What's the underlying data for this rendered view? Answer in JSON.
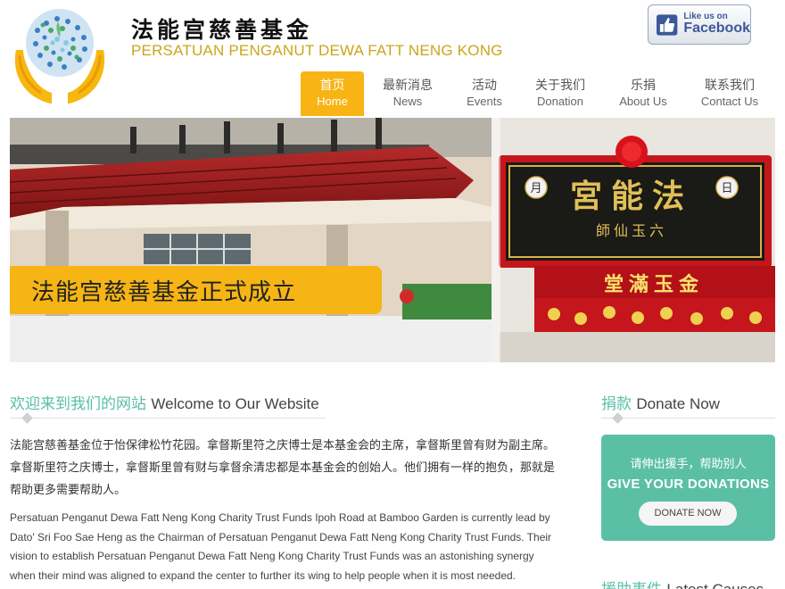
{
  "site": {
    "title_cn": "法能宫慈善基金",
    "title_en": "PERSATUAN PENGANUT DEWA FATT NENG KONG"
  },
  "facebook": {
    "small": "Like us on",
    "big": "Facebook"
  },
  "nav": [
    {
      "cn": "首页",
      "en": "Home",
      "active": true
    },
    {
      "cn": "最新消息",
      "en": "News",
      "active": false
    },
    {
      "cn": "活动",
      "en": "Events",
      "active": false
    },
    {
      "cn": "关于我们",
      "en": "Donation",
      "active": false
    },
    {
      "cn": "乐捐",
      "en": "About Us",
      "active": false
    },
    {
      "cn": "联系我们",
      "en": "Contact Us",
      "active": false
    }
  ],
  "banner": {
    "caption": "法能宫慈善基金正式成立",
    "sign_main": "宮能法",
    "sign_sub": "師仙玉六",
    "sign_left": "月",
    "sign_right": "日",
    "red_board": "堂滿玉金"
  },
  "welcome": {
    "heading_cn": "欢迎来到我们的网站",
    "heading_en": "Welcome to Our Website",
    "para_cn": "法能宫慈善基金位于怡保律松竹花园。拿督斯里符之庆博士是本基金会的主席，拿督斯里曾有财为副主席。拿督斯里符之庆博士，拿督斯里曾有财与拿督余清忠都是本基金会的创始人。他们拥有一样的抱负，那就是帮助更多需要帮助人。",
    "para_en": "Persatuan Penganut Dewa Fatt Neng Kong Charity Trust Funds Ipoh Road at Bamboo Garden is currently lead by Dato' Sri Foo Sae Heng as the Chairman of Persatuan Penganut Dewa Fatt Neng Kong Charity Trust Funds. Their vision to establish Persatuan Penganut Dewa Fatt Neng Kong Charity Trust Funds was an astonishing synergy when their mind was aligned to expand the center to further its wing to help people when it is most needed."
  },
  "donate": {
    "heading_cn": "捐款",
    "heading_en": "Donate Now",
    "text_cn": "请伸出援手，帮助别人",
    "text_en": "GIVE YOUR DONATIONS",
    "button": "DONATE NOW"
  },
  "causes": {
    "heading_cn": "援助事件",
    "heading_en": "Latest Causes"
  },
  "colors": {
    "accent_yellow": "#f8b415",
    "accent_teal": "#5bbfa6",
    "gold_text": "#c9a61b"
  }
}
